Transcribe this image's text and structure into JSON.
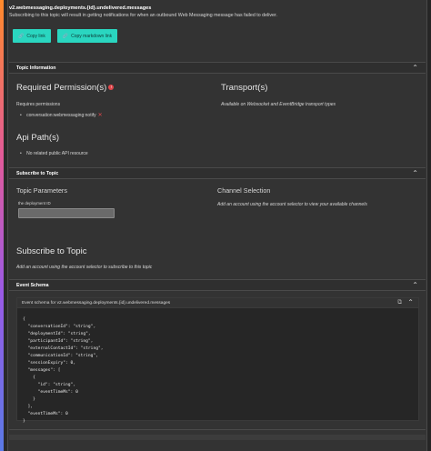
{
  "topic": {
    "title": "v2.webmessaging.deployments.{id}.undelivered.messages",
    "description": "Subscribing to this topic will result in getting notifications for when an outbound Web Messaging message has failed to deliver."
  },
  "buttons": {
    "copy_link": "Copy link",
    "copy_markdown": "Copy markdown link"
  },
  "topic_information": {
    "header": "Topic Information",
    "required_permissions_title": "Required Permission(s)",
    "requires_label": "Requires permissions",
    "permission": "conversation:webmessaging:notify",
    "transports_title": "Transport(s)",
    "transports_text": "Available on Websocket and EventBridge transport types",
    "api_paths_title": "Api Path(s)",
    "api_paths_text": "No related public API resource"
  },
  "subscribe": {
    "header": "Subscribe to Topic",
    "topic_params_title": "Topic Parameters",
    "deployment_id_label": "the deployment ID",
    "deployment_id_value": "",
    "channel_selection_title": "Channel Selection",
    "channel_selection_text": "Add an account using the account selector to view your available channels",
    "subscribe_title": "Subscribe to Topic",
    "subscribe_text": "Add an account using the account selector to subscribe to this topic"
  },
  "event_schema": {
    "header": "Event Schema",
    "box_label": "Event schema for v2.webmessaging.deployments.{id}.undelivered.messages",
    "code": "{\n  \"conversationId\": \"string\",\n  \"deploymentId\": \"string\",\n  \"participantId\": \"string\",\n  \"externalContactId\": \"string\",\n  \"communicationId\": \"string\",\n  \"sessionExpiry\": 0,\n  \"messages\": [\n    {\n      \"id\": \"string\",\n      \"eventTimeMs\": 0\n    }\n  ],\n  \"eventTimeMs\": 0\n}"
  },
  "colors": {
    "button_bg": "#2ad6c0",
    "error": "#e0474c",
    "background": "#333333"
  }
}
